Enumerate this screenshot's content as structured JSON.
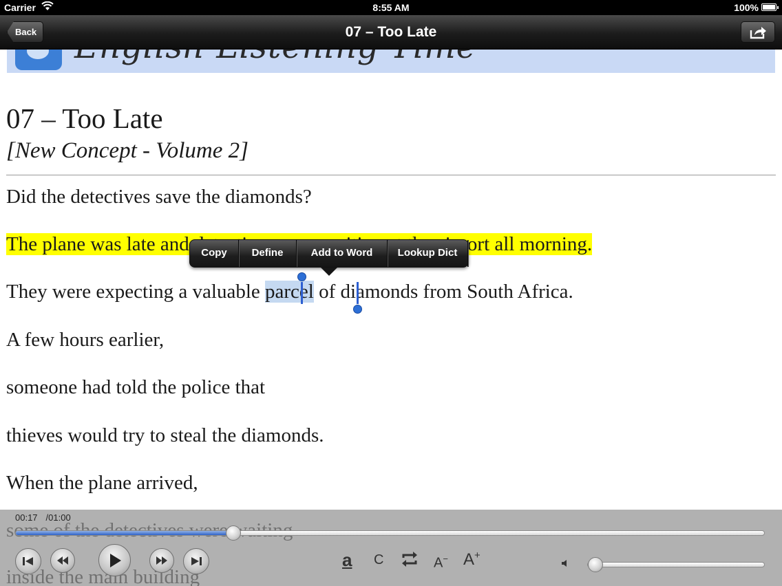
{
  "status_bar": {
    "carrier": "Carrier",
    "time": "8:55 AM",
    "battery": "100%"
  },
  "nav": {
    "back_label": "Back",
    "title": "07 – Too Late",
    "share_icon": "share-icon"
  },
  "banner": {
    "text": "English Listening Time"
  },
  "article": {
    "heading": "07 – Too Late",
    "subheading": "[New Concept - Volume 2]",
    "line1": "Did the detectives save the diamonds?",
    "line2": "The plane was late and detectives were waiting at the airport all morning.",
    "line3_pre": "They were expecting a valuable ",
    "line3_sel": "parcel",
    "line3_post": " of diamonds from South Africa.",
    "line4": "A few hours earlier,",
    "line5": "someone had told the police that",
    "line6": "thieves would try to steal the diamonds.",
    "line7": "When the plane arrived,",
    "line8": "some of the detectives were waiting",
    "line9": "inside the main building"
  },
  "edit_menu": {
    "items": [
      "Copy",
      "Define",
      "Add to Word",
      "Lookup Dict"
    ]
  },
  "colors": {
    "highlight": "#ffff00",
    "selection": "#c5d9f1",
    "accent": "#2d6fd6"
  },
  "player": {
    "elapsed": "00:17",
    "total": "/01:00",
    "progress": 0.29,
    "volume": 0.0,
    "text_size_tool": "a",
    "clear_tool": "C",
    "decrease_font": "A",
    "increase_font": "A",
    "icons": [
      "skip-back-icon",
      "rewind-icon",
      "play-icon",
      "fast-forward-icon",
      "skip-forward-icon",
      "repeat-icon",
      "speaker-icon"
    ]
  }
}
